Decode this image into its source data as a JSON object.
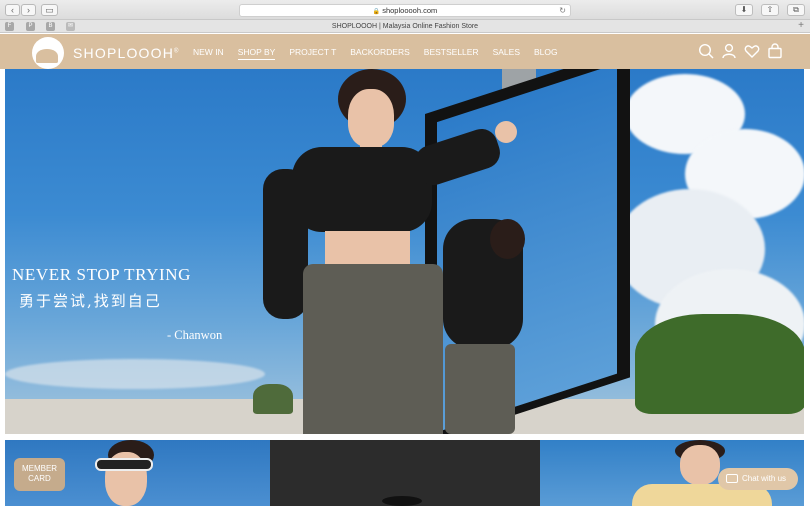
{
  "browser": {
    "url": "shoplooooh.com",
    "tab_title": "SHOPLOOOH | Malaysia Online Fashion Store",
    "favicons": [
      "F",
      "P",
      "B",
      "✉"
    ],
    "new_tab": "+"
  },
  "site": {
    "logo": "SHOPLOOOH",
    "logo_reg": "®",
    "nav": [
      {
        "label": "NEW IN"
      },
      {
        "label": "SHOP BY"
      },
      {
        "label": "PROJECT T"
      },
      {
        "label": "BACKORDERS"
      },
      {
        "label": "BESTSELLER"
      },
      {
        "label": "SALES"
      },
      {
        "label": "BLOG"
      }
    ],
    "icons": [
      "search-icon",
      "account-icon",
      "wishlist-icon",
      "cart-icon"
    ],
    "brand_color": "#d9bf9f"
  },
  "hero": {
    "title": "NEVER STOP TRYING",
    "subtitle": "勇于尝试,找到自己",
    "author": "- Chanwon"
  },
  "widgets": {
    "member_card_line1": "MEMBER",
    "member_card_line2": "CARD",
    "chat": "Chat with us"
  }
}
